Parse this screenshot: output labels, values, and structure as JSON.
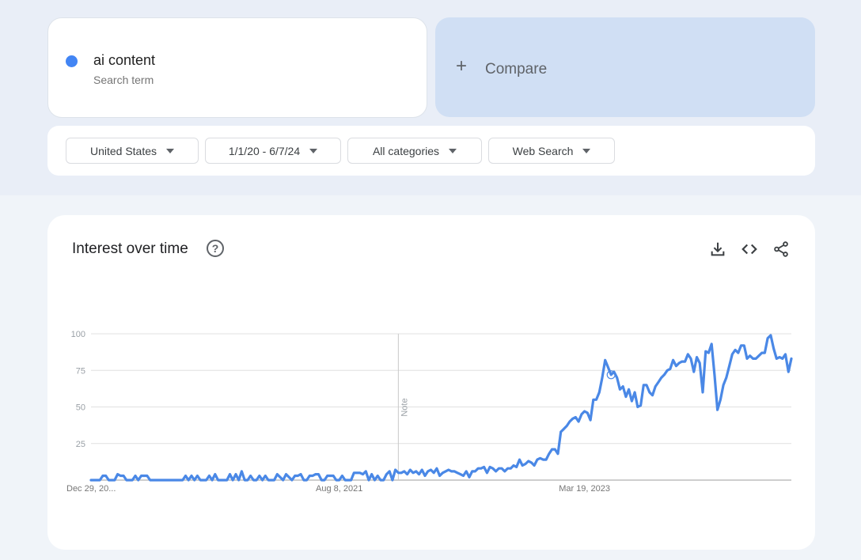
{
  "search_term": {
    "name": "ai content",
    "subtitle": "Search term",
    "color": "#4285f4"
  },
  "compare": {
    "icon": "plus-icon",
    "label": "Compare"
  },
  "filters": [
    {
      "label": "United States"
    },
    {
      "label": "1/1/20 - 6/7/24"
    },
    {
      "label": "All categories"
    },
    {
      "label": "Web Search"
    }
  ],
  "card": {
    "title": "Interest over time",
    "help_icon": "help-circle-icon",
    "actions": [
      "download-icon",
      "embed-code-icon",
      "share-icon"
    ]
  },
  "colors": {
    "line": "#4a88e6",
    "grid": "#e0e0e0",
    "accent_compare": "#d0dff4"
  },
  "chart_data": {
    "type": "line",
    "title": "Interest over time",
    "xlabel": "",
    "ylabel": "",
    "ylim": [
      0,
      100
    ],
    "yticks": [
      25,
      50,
      75,
      100
    ],
    "grid": true,
    "x_tick_labels": [
      {
        "label": "Dec 29, 20...",
        "index": 0
      },
      {
        "label": "Aug 8, 2021",
        "index": 84
      },
      {
        "label": "Mar 19, 2023",
        "index": 167
      }
    ],
    "annotation": {
      "label": "Note",
      "index": 104
    },
    "highlight_index": 176,
    "series": [
      {
        "name": "ai content",
        "values": [
          0,
          0,
          0,
          0,
          3,
          3,
          0,
          0,
          0,
          4,
          3,
          3,
          0,
          0,
          0,
          3,
          0,
          3,
          3,
          3,
          0,
          0,
          0,
          0,
          0,
          0,
          0,
          0,
          0,
          0,
          0,
          0,
          3,
          0,
          3,
          0,
          3,
          0,
          0,
          0,
          3,
          0,
          4,
          0,
          0,
          0,
          0,
          4,
          0,
          4,
          0,
          6,
          0,
          0,
          3,
          0,
          0,
          3,
          0,
          3,
          0,
          0,
          0,
          4,
          2,
          0,
          4,
          2,
          0,
          3,
          3,
          4,
          0,
          0,
          3,
          3,
          4,
          4,
          0,
          0,
          3,
          3,
          3,
          0,
          0,
          3,
          0,
          0,
          0,
          5,
          5,
          5,
          4,
          6,
          0,
          4,
          0,
          3,
          0,
          0,
          4,
          6,
          0,
          7,
          5,
          5,
          6,
          4,
          7,
          5,
          6,
          4,
          7,
          3,
          6,
          7,
          5,
          8,
          3,
          5,
          6,
          7,
          6,
          6,
          5,
          4,
          3,
          6,
          2,
          6,
          6,
          8,
          8,
          9,
          5,
          9,
          8,
          6,
          8,
          8,
          6,
          8,
          8,
          10,
          9,
          14,
          10,
          11,
          13,
          12,
          10,
          14,
          15,
          14,
          14,
          18,
          21,
          21,
          18,
          33,
          35,
          37,
          40,
          42,
          43,
          40,
          45,
          47,
          46,
          41,
          55,
          55,
          60,
          70,
          82,
          77,
          72,
          74,
          70,
          62,
          64,
          57,
          62,
          54,
          60,
          50,
          51,
          65,
          65,
          60,
          58,
          64,
          67,
          70,
          72,
          75,
          76,
          82,
          78,
          80,
          81,
          81,
          86,
          83,
          74,
          84,
          80,
          60,
          88,
          87,
          93,
          72,
          48,
          55,
          65,
          70,
          78,
          86,
          89,
          87,
          92,
          92,
          83,
          85,
          83,
          83,
          85,
          87,
          87,
          97,
          99,
          90,
          83,
          84,
          83,
          86,
          74,
          83
        ]
      }
    ]
  }
}
